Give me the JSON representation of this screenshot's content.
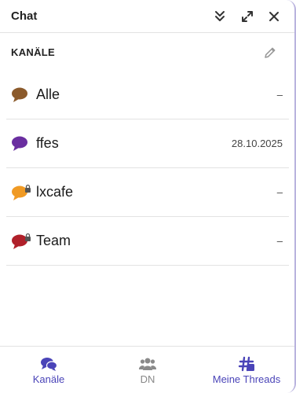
{
  "header": {
    "title": "Chat",
    "icons": [
      "collapse-icon",
      "expand-icon",
      "close-icon"
    ]
  },
  "section": {
    "title": "KANÄLE",
    "edit_icon": "pencil-icon"
  },
  "channels": [
    {
      "name": "Alle",
      "meta": "–",
      "icon_color": "#8b5a2b",
      "locked": false
    },
    {
      "name": "ffes",
      "meta": "28.10.2025",
      "icon_color": "#6a2ea0",
      "locked": false
    },
    {
      "name": "lxcafe",
      "meta": "–",
      "icon_color": "#f09a24",
      "locked": true
    },
    {
      "name": "Team",
      "meta": "–",
      "icon_color": "#b0202a",
      "locked": true
    }
  ],
  "nav": [
    {
      "label": "Kanäle",
      "icon": "chat-bubbles-icon",
      "active": true
    },
    {
      "label": "DN",
      "icon": "users-icon",
      "active": false
    },
    {
      "label": "Meine Threads",
      "icon": "hashtag-icon",
      "active": true
    }
  ],
  "colors": {
    "accent": "#4a44b8",
    "inactive": "#888888",
    "border": "#b9b3de"
  }
}
